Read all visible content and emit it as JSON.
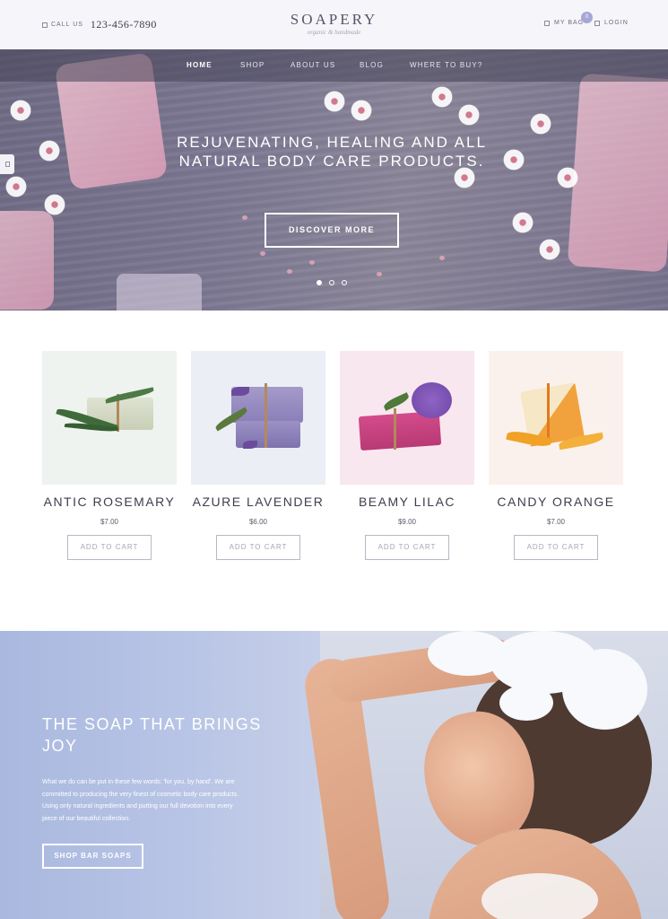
{
  "header": {
    "phone_label": "CALL US",
    "phone_number": "123-456-7890",
    "logo": "SOAPERY",
    "logo_tagline": "organic & handmade",
    "bag_label": "MY BAG",
    "bag_count": "0",
    "login_label": "LOGIN"
  },
  "nav": {
    "items": [
      "HOME",
      "SHOP",
      "ABOUT US",
      "BLOG",
      "WHERE TO BUY?"
    ],
    "active": "HOME"
  },
  "hero": {
    "title": "REJUVENATING, HEALING AND ALL NATURAL BODY CARE PRODUCTS.",
    "button": "DISCOVER MORE",
    "slides": 3,
    "active_slide": 1
  },
  "products": [
    {
      "name": "ANTIC ROSEMARY",
      "price": "$7.00",
      "cta": "ADD TO CART",
      "bg": "#eef3ef"
    },
    {
      "name": "AZURE LAVENDER",
      "price": "$6.00",
      "cta": "ADD TO CART",
      "bg": "#eceef5"
    },
    {
      "name": "BEAMY LILAC",
      "price": "$9.00",
      "cta": "ADD TO CART",
      "bg": "#f8e7ef"
    },
    {
      "name": "CANDY ORANGE",
      "price": "$7.00",
      "cta": "ADD TO CART",
      "bg": "#fbf1ec"
    }
  ],
  "promo": {
    "title": "THE SOAP THAT BRINGS JOY",
    "text": "What we do can be put in these few words: 'for you, by hand'. We are committed to producing the very finest of cosmetic body care products. Using only natural ingredients and putting our full devotion into every piece of our beautiful collection.",
    "button": "SHOP BAR SOAPS"
  },
  "colors": {
    "accent": "#a6a6d8",
    "topbar_bg": "#f6f6fa",
    "promo_bg": "#aebde0"
  },
  "icons": [
    "phone-icon",
    "bag-icon",
    "user-icon",
    "side-tab-icon"
  ]
}
